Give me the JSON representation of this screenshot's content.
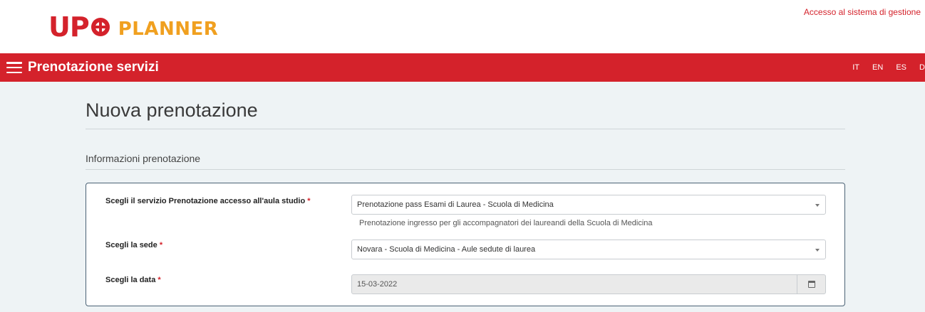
{
  "header": {
    "logo_upo": "UP",
    "logo_planner": "PLANNER",
    "management_link": "Accesso al sistema di gestione"
  },
  "navbar": {
    "title": "Prenotazione servizi",
    "languages": [
      "IT",
      "EN",
      "ES",
      "D"
    ]
  },
  "page": {
    "title": "Nuova prenotazione",
    "section_title": "Informazioni prenotazione"
  },
  "form": {
    "required_mark": "*",
    "service": {
      "label": "Scegli il servizio Prenotazione accesso all'aula studio",
      "value": "Prenotazione pass Esami di Laurea - Scuola di Medicina",
      "hint": "Prenotazione ingresso per gli accompagnatori dei laureandi della Scuola di Medicina"
    },
    "location": {
      "label": "Scegli la sede",
      "value": "Novara - Scuola di Medicina - Aule sedute di laurea"
    },
    "date": {
      "label": "Scegli la data",
      "value": "15-03-2022"
    }
  },
  "colors": {
    "brand_red": "#d4222b",
    "brand_orange": "#f0a020",
    "content_bg": "#eef3f5"
  }
}
